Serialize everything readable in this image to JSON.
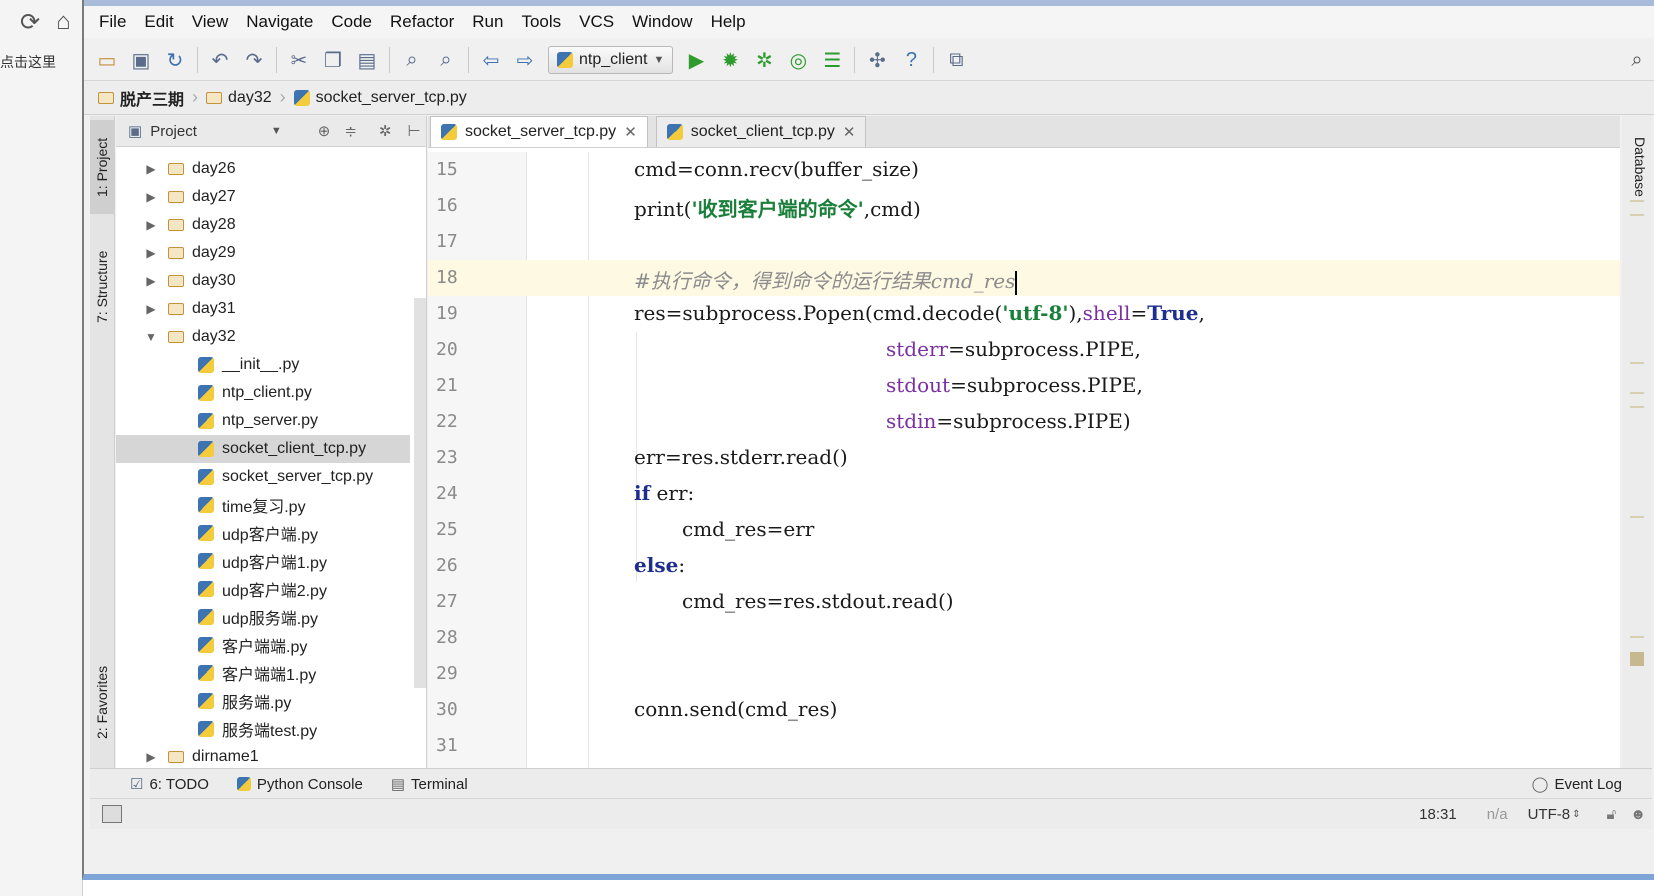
{
  "browser": {
    "partial_text": "点击这里"
  },
  "menu": [
    "File",
    "Edit",
    "View",
    "Navigate",
    "Code",
    "Refactor",
    "Run",
    "Tools",
    "VCS",
    "Window",
    "Help"
  ],
  "toolbar": {
    "run_config": "ntp_client"
  },
  "breadcrumb": [
    "脱产三期",
    "day32",
    "socket_server_tcp.py"
  ],
  "left_rail": {
    "project": "1: Project",
    "structure": "7: Structure",
    "favorites": "2: Favorites"
  },
  "project_panel": {
    "header": "Project",
    "items": [
      {
        "label": "day26",
        "type": "folder",
        "expanded": false
      },
      {
        "label": "day27",
        "type": "folder",
        "expanded": false
      },
      {
        "label": "day28",
        "type": "folder",
        "expanded": false
      },
      {
        "label": "day29",
        "type": "folder",
        "expanded": false
      },
      {
        "label": "day30",
        "type": "folder",
        "expanded": false
      },
      {
        "label": "day31",
        "type": "folder",
        "expanded": false
      },
      {
        "label": "day32",
        "type": "folder",
        "expanded": true
      },
      {
        "label": "__init__.py",
        "type": "file"
      },
      {
        "label": "ntp_client.py",
        "type": "file"
      },
      {
        "label": "ntp_server.py",
        "type": "file"
      },
      {
        "label": "socket_client_tcp.py",
        "type": "file",
        "selected": true
      },
      {
        "label": "socket_server_tcp.py",
        "type": "file"
      },
      {
        "label": "time复习.py",
        "type": "file"
      },
      {
        "label": "udp客户端.py",
        "type": "file"
      },
      {
        "label": "udp客户端1.py",
        "type": "file"
      },
      {
        "label": "udp客户端2.py",
        "type": "file"
      },
      {
        "label": "udp服务端.py",
        "type": "file"
      },
      {
        "label": "客户端端.py",
        "type": "file"
      },
      {
        "label": "客户端端1.py",
        "type": "file"
      },
      {
        "label": "服务端.py",
        "type": "file"
      },
      {
        "label": "服务端test.py",
        "type": "file"
      },
      {
        "label": "dirname1",
        "type": "folder",
        "expanded": false
      }
    ]
  },
  "tabs": [
    {
      "label": "socket_server_tcp.py",
      "active": true
    },
    {
      "label": "socket_client_tcp.py",
      "active": false
    }
  ],
  "code": {
    "current_line": 18,
    "lines": [
      {
        "num": "15",
        "parts": [
          [
            "cmd=conn.recv(buffer_size)",
            ""
          ]
        ]
      },
      {
        "num": "16",
        "parts": [
          [
            "print(",
            ""
          ],
          [
            "'收到客户端的命令'",
            "str"
          ],
          [
            ",cmd)",
            ""
          ]
        ]
      },
      {
        "num": "17",
        "parts": []
      },
      {
        "num": "18",
        "parts": [
          [
            "#执行命令，得到命令的运行结果cmd_res",
            "cmt"
          ]
        ]
      },
      {
        "num": "19",
        "parts": [
          [
            "res=subprocess.Popen(cmd.decode(",
            ""
          ],
          [
            "'utf-8'",
            "str"
          ],
          [
            "),",
            ""
          ],
          [
            "shell",
            "param"
          ],
          [
            "=",
            ""
          ],
          [
            "True",
            "kw"
          ],
          [
            ",",
            ""
          ]
        ]
      },
      {
        "num": "20",
        "parts": [
          [
            "stderr",
            "param"
          ],
          [
            "=subprocess.PIPE,",
            ""
          ]
        ]
      },
      {
        "num": "21",
        "parts": [
          [
            "stdout",
            "param"
          ],
          [
            "=subprocess.PIPE,",
            ""
          ]
        ]
      },
      {
        "num": "22",
        "parts": [
          [
            "stdin",
            "param"
          ],
          [
            "=subprocess.PIPE)",
            ""
          ]
        ]
      },
      {
        "num": "23",
        "parts": [
          [
            "err=res.stderr.read()",
            ""
          ]
        ]
      },
      {
        "num": "24",
        "parts": [
          [
            "if",
            "kw"
          ],
          [
            " err:",
            ""
          ]
        ]
      },
      {
        "num": "25",
        "parts": [
          [
            "cmd_res=err",
            ""
          ]
        ]
      },
      {
        "num": "26",
        "parts": [
          [
            "else",
            "kw"
          ],
          [
            ":",
            ""
          ]
        ]
      },
      {
        "num": "27",
        "parts": [
          [
            "cmd_res=res.stdout.read()",
            ""
          ]
        ]
      },
      {
        "num": "28",
        "parts": []
      },
      {
        "num": "29",
        "parts": []
      },
      {
        "num": "30",
        "parts": [
          [
            "conn.send(cmd_res)",
            ""
          ]
        ]
      },
      {
        "num": "31",
        "parts": []
      }
    ]
  },
  "right_rail": {
    "database": "Database"
  },
  "bottom_tools": [
    {
      "label": "6: TODO",
      "icon": "todo-icon"
    },
    {
      "label": "Python Console",
      "icon": "python-console-icon"
    },
    {
      "label": "Terminal",
      "icon": "terminal-icon"
    }
  ],
  "event_log": "Event Log",
  "status": {
    "position": "18:31",
    "na": "n/a",
    "encoding": "UTF-8"
  },
  "colors": {
    "keyword": "#1d2e8f",
    "string": "#1a7f3a",
    "param": "#7a2fa3",
    "comment": "#8c8c8c",
    "current_line": "#fdf9e3",
    "run_green": "#2e9b2e"
  }
}
